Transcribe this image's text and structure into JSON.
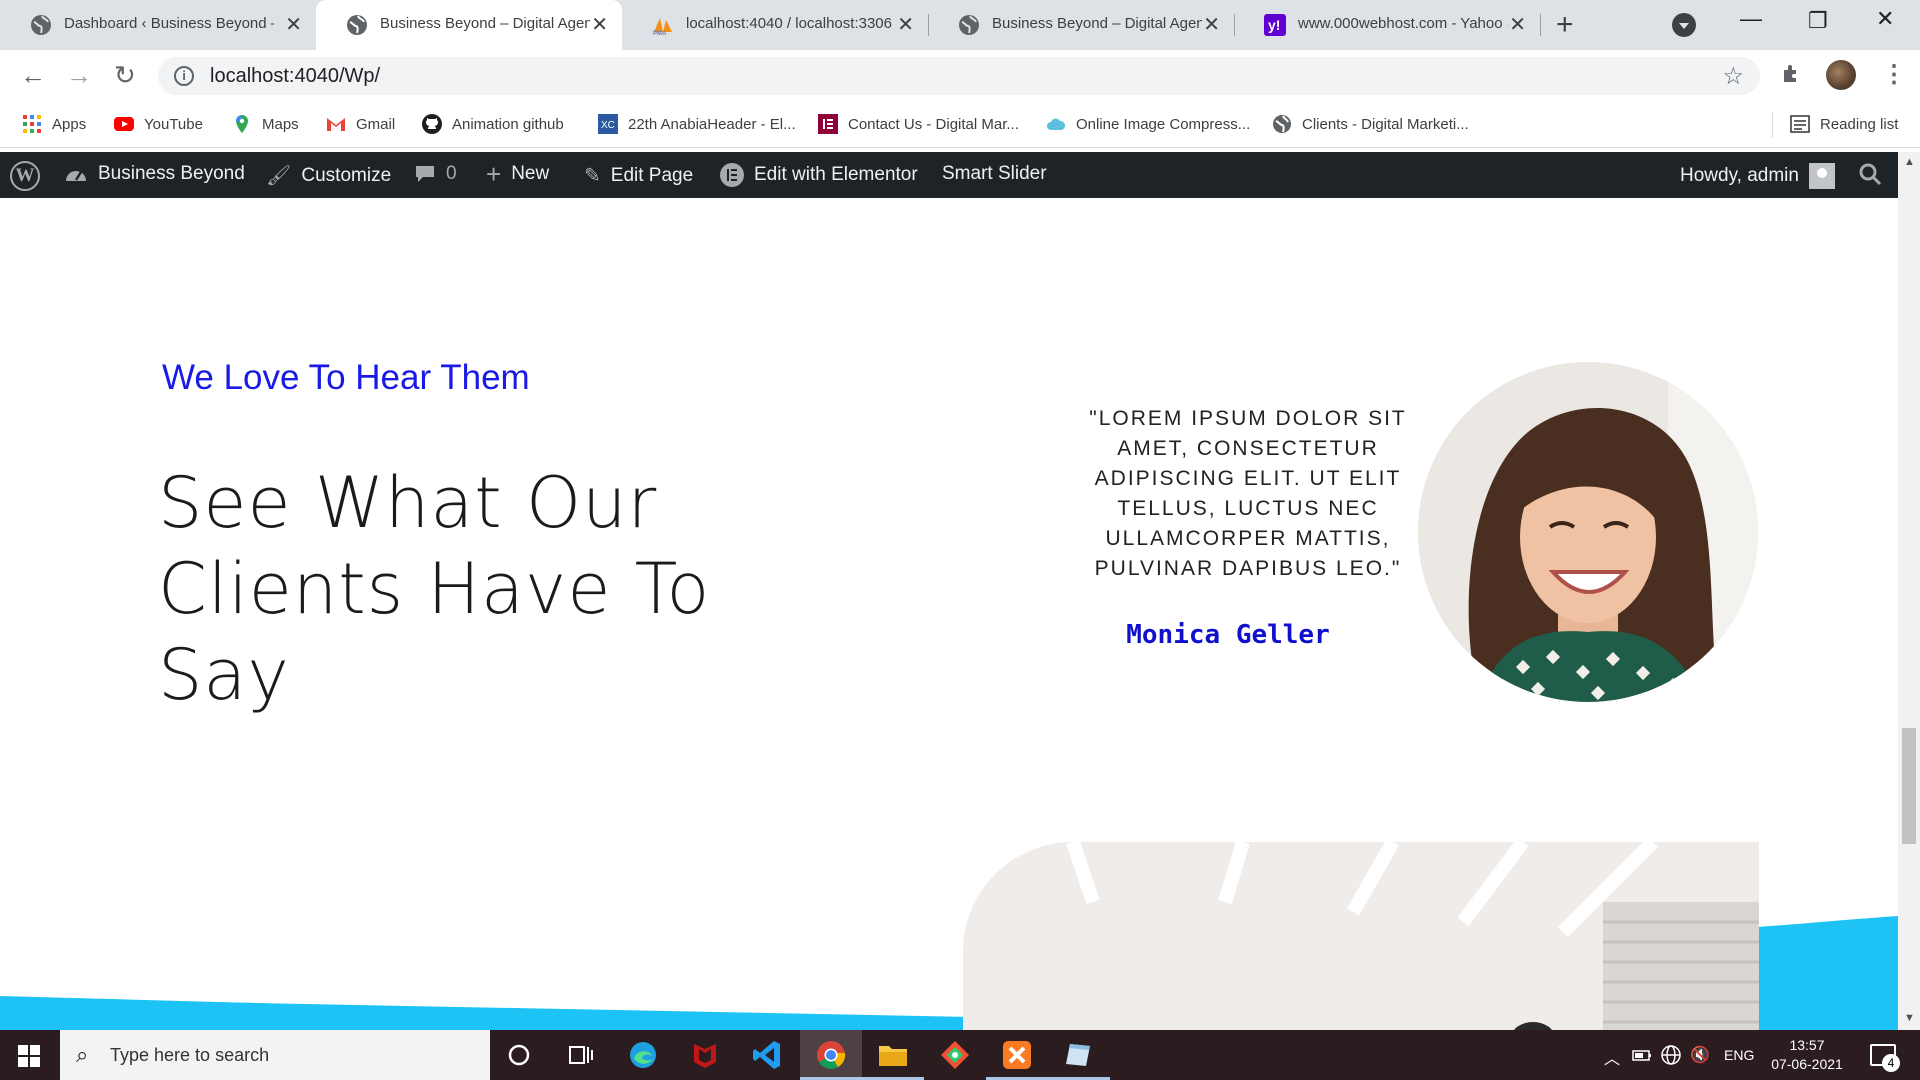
{
  "browser": {
    "tabs": [
      {
        "title": "Dashboard ‹ Business Beyond —",
        "icon": "globe-icon"
      },
      {
        "title": "Business Beyond – Digital Agenc",
        "icon": "globe-icon"
      },
      {
        "title": "localhost:4040 / localhost:3306 /",
        "icon": "phpmyadmin-icon"
      },
      {
        "title": "Business Beyond – Digital Agenc",
        "icon": "globe-icon"
      },
      {
        "title": "www.000webhost.com - Yahoo S",
        "icon": "yahoo-icon"
      }
    ],
    "url": "localhost:4040/Wp/",
    "bookmarks": [
      {
        "label": "Apps",
        "icon": "apps-grid-icon"
      },
      {
        "label": "YouTube",
        "icon": "youtube-icon"
      },
      {
        "label": "Maps",
        "icon": "maps-icon"
      },
      {
        "label": "Gmail",
        "icon": "gmail-icon"
      },
      {
        "label": "Animation github",
        "icon": "github-icon"
      },
      {
        "label": "22th AnabiaHeader - El...",
        "icon": "site-icon"
      },
      {
        "label": "Contact Us - Digital Mar...",
        "icon": "elementor-icon"
      },
      {
        "label": "Online Image Compress...",
        "icon": "cloud-icon"
      },
      {
        "label": "Clients - Digital Marketi...",
        "icon": "globe-icon"
      }
    ],
    "reading_list": "Reading list"
  },
  "wp_admin_bar": {
    "site_name": "Business Beyond",
    "customize": "Customize",
    "comments_count": "0",
    "new": "New",
    "edit_page": "Edit Page",
    "edit_elementor": "Edit with Elementor",
    "smart_slider": "Smart Slider",
    "howdy": "Howdy, admin"
  },
  "testimonial": {
    "kicker": "We Love To Hear Them",
    "headline_line1": "See What Our",
    "headline_line2": "Clients Have To Say",
    "quote": "\"LOREM IPSUM DOLOR SIT AMET, CONSECTETUR ADIPISCING ELIT. UT ELIT TELLUS, LUCTUS NEC ULLAMCORPER MATTIS, PULVINAR DAPIBUS LEO.\"",
    "author": "Monica Geller"
  },
  "taskbar": {
    "search_placeholder": "Type here to search",
    "language": "ENG",
    "time": "13:57",
    "date": "07-06-2021",
    "notifications": "4"
  },
  "colors": {
    "kicker": "#1a1ae6",
    "author": "#1010cc",
    "wave": "#1ec3f5",
    "wp_bar": "#1d2327"
  }
}
